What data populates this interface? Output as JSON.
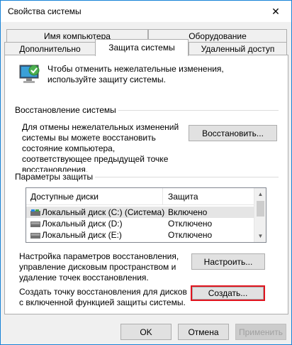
{
  "window": {
    "title": "Свойства системы"
  },
  "tabs": {
    "row1": [
      "Имя компьютера",
      "Оборудование"
    ],
    "row2": [
      "Дополнительно",
      "Защита системы",
      "Удаленный доступ"
    ]
  },
  "intro": {
    "text": "Чтобы отменить нежелательные изменения, используйте защиту системы."
  },
  "restore": {
    "group_label": "Восстановление системы",
    "description": "Для отмены нежелательных изменений системы вы можете восстановить состояние компьютера, соответствующее предыдущей точке восстановления.",
    "button": "Восстановить..."
  },
  "protection": {
    "group_label": "Параметры защиты",
    "columns": [
      "Доступные диски",
      "Защита"
    ],
    "drives": [
      {
        "name": "Локальный диск (C:) (Система)",
        "status": "Включено"
      },
      {
        "name": "Локальный диск (D:)",
        "status": "Отключено"
      },
      {
        "name": "Локальный диск (E:)",
        "status": "Отключено"
      }
    ],
    "configure_text": "Настройка параметров восстановления, управление дисковым пространством и удаление точек восстановления.",
    "configure_button": "Настроить...",
    "create_text": "Создать точку восстановления для дисков с включенной функцией защиты системы.",
    "create_button": "Создать..."
  },
  "footer": {
    "ok": "OK",
    "cancel": "Отмена",
    "apply": "Применить"
  },
  "colors": {
    "highlight": "#e0141e",
    "accent": "#1883d7"
  }
}
